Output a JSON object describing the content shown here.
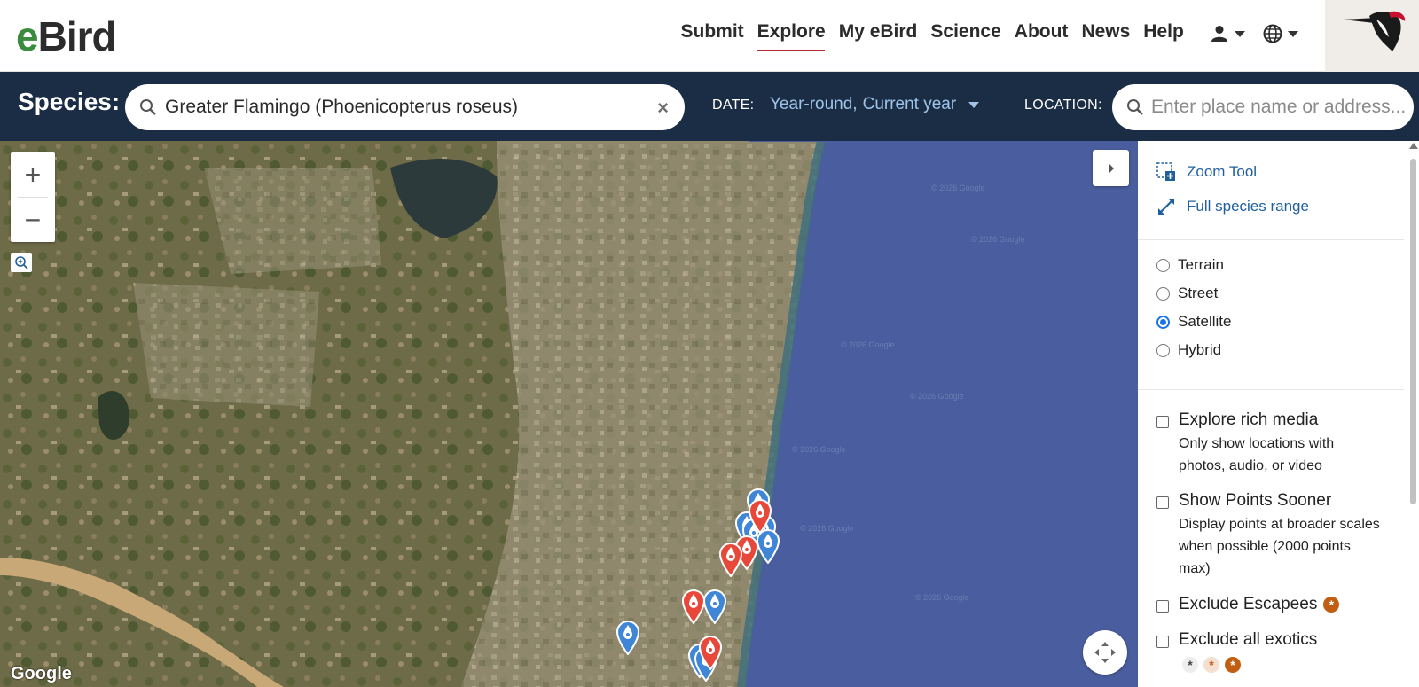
{
  "header": {
    "logo_e": "e",
    "logo_rest": "Bird",
    "nav": [
      {
        "label": "Submit",
        "active": false
      },
      {
        "label": "Explore",
        "active": true
      },
      {
        "label": "My eBird",
        "active": false
      },
      {
        "label": "Science",
        "active": false
      },
      {
        "label": "About",
        "active": false
      },
      {
        "label": "News",
        "active": false
      },
      {
        "label": "Help",
        "active": false
      }
    ]
  },
  "search": {
    "species_label": "Species:",
    "species_value": "Greater Flamingo (Phoenicopterus roseus)",
    "clear_glyph": "×",
    "date_label": "DATE:",
    "date_range": "Year-round,",
    "date_year": "Current year",
    "location_label": "LOCATION:",
    "location_placeholder": "Enter place name or address..."
  },
  "map": {
    "zoom_in": "+",
    "zoom_out": "−",
    "attribution": "Google",
    "watermark": "© 2026 Google",
    "ocean_color": "#4a5e9f",
    "land_color": "#6b6a45",
    "marker_colors": {
      "recent": "#e8483a",
      "older": "#3f86d6"
    }
  },
  "panel": {
    "zoom_tool": "Zoom Tool",
    "full_range": "Full species range",
    "map_types": [
      {
        "label": "Terrain",
        "checked": false
      },
      {
        "label": "Street",
        "checked": false
      },
      {
        "label": "Satellite",
        "checked": true
      },
      {
        "label": "Hybrid",
        "checked": false
      }
    ],
    "rich_media_title": "Explore rich media",
    "rich_media_desc": "Only show locations with photos, audio, or video",
    "points_sooner_title": "Show Points Sooner",
    "points_sooner_desc": "Display points at broader scales when possible (2000 points max)",
    "escapees_title": "Exclude Escapees",
    "exotics_title": "Exclude all exotics",
    "exotic_glyph": "*"
  }
}
